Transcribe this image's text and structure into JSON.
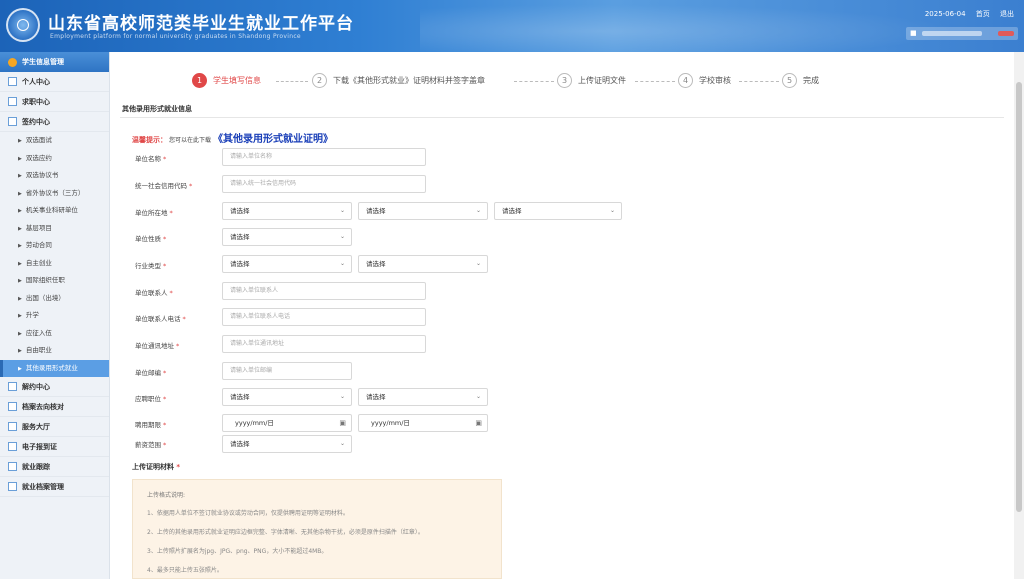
{
  "header": {
    "title": "山东省高校师范类毕业生就业工作平台",
    "subtitle": "Employment platform for normal university graduates in Shandong Province",
    "date": "2025-06-04",
    "home": "首页",
    "logout": "退出"
  },
  "sidebar": {
    "top": "学生信息管理",
    "personal": "个人中心",
    "job": "求职中心",
    "sign": "签约中心",
    "subitems": [
      "双选面试",
      "双选应约",
      "双选协议书",
      "省外协议书（三方）",
      "机关事业科研单位",
      "基层项目",
      "劳动合同",
      "自主创业",
      "国际组织任职",
      "出国（出境）",
      "升学",
      "应征入伍",
      "自由职业",
      "其他录用形式就业"
    ],
    "bottom": [
      "解约中心",
      "档案去向核对",
      "服务大厅",
      "电子报到证",
      "就业跟踪",
      "就业档案管理"
    ]
  },
  "steps": [
    {
      "num": "1",
      "label": "学生填写信息"
    },
    {
      "num": "2",
      "label": "下载《其他形式就业》证明材料并签字盖章"
    },
    {
      "num": "3",
      "label": "上传证明文件"
    },
    {
      "num": "4",
      "label": "学校审核"
    },
    {
      "num": "5",
      "label": "完成"
    }
  ],
  "form": {
    "section_title": "其他录用形式就业信息",
    "hint_label": "温馨提示：",
    "hint_text": "您可以在此下载",
    "hint_link": "《其他录用形式就业证明》",
    "select_text": "请选择",
    "date_placeholder": "yyyy/mm/日",
    "labels": {
      "unit_name": "单位名称",
      "credit_code": "统一社会信用代码",
      "unit_location": "单位所在地",
      "unit_nature": "单位性质",
      "industry": "行业类型",
      "contact": "单位联系人",
      "contact_phone": "单位联系人电话",
      "address": "单位通讯地址",
      "postcode": "单位邮编",
      "position": "应聘职位",
      "period": "聘用期限",
      "salary": "薪资范围"
    },
    "placeholders": {
      "unit_name": "请输入单位名称",
      "credit_code": "请输入统一社会信用代码",
      "contact": "请输入单位联系人",
      "contact_phone": "请输入单位联系人电话",
      "address": "请输入单位通讯地址",
      "postcode": "请输入单位邮编"
    }
  },
  "upload": {
    "label": "上传证明材料",
    "title": "上传格式说明:",
    "items": [
      "1、依据用人单位不签订就业协议或劳动合同，仅提供聘用证明等证明材料。",
      "2、上传的其他录用形式就业证明应边框完整、字体清晰、无其他杂物干扰，必须是原件扫描件（红章）。",
      "3、上传照片扩展名为jpg、JPG、png、PNG，大小不能超过4MB。",
      "4、最多只能上传五张照片。"
    ]
  }
}
